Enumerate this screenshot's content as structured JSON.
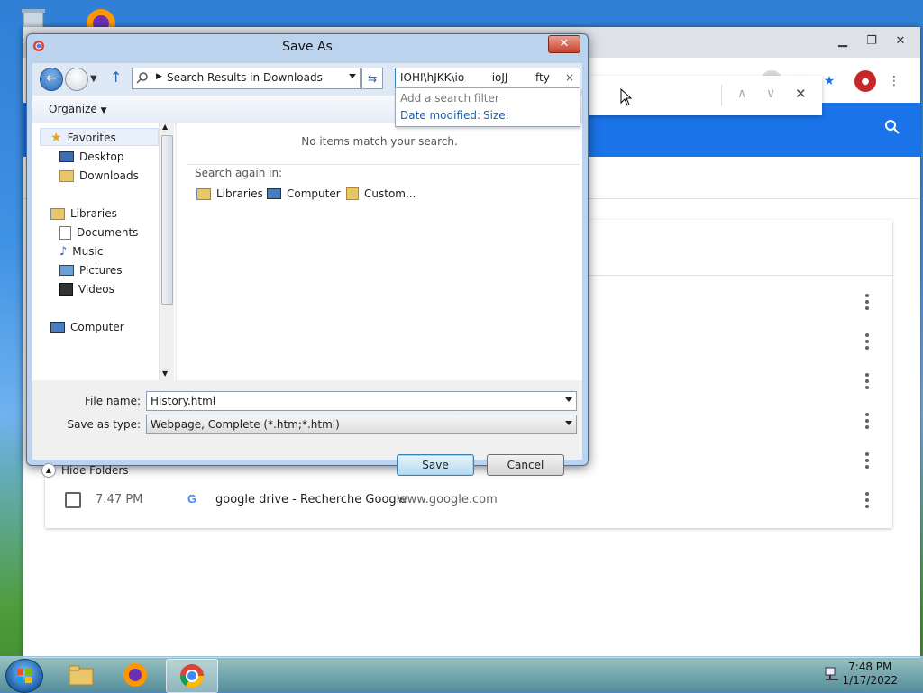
{
  "dialog": {
    "title": "Save As",
    "close_glyph": "✕",
    "address_text": "Search Results in Downloads",
    "search_text": "IOHI\\hJKK\\io        ioJJ        fty",
    "search_clear": "×",
    "filter": {
      "hint": "Add a search filter",
      "date_modified": "Date modified:",
      "size": "Size:"
    },
    "organize": "Organize",
    "nav": {
      "favorites": "Favorites",
      "desktop": "Desktop",
      "downloads": "Downloads",
      "libraries": "Libraries",
      "documents": "Documents",
      "music": "Music",
      "pictures": "Pictures",
      "videos": "Videos",
      "computer": "Computer"
    },
    "no_items": "No items match your search.",
    "search_again": "Search again in:",
    "search_locations": [
      "Libraries",
      "Computer",
      "Custom..."
    ],
    "file_name_label": "File name:",
    "file_name_value": "History.html",
    "save_type_label": "Save as type:",
    "save_type_value": "Webpage, Complete (*.htm;*.html)",
    "hide_folders": "Hide Folders",
    "save_button": "Save",
    "cancel_button": "Cancel"
  },
  "chrome": {
    "history_row": {
      "time": "7:47 PM",
      "title": "google drive - Recherche Google",
      "domain": "www.google.com"
    }
  },
  "taskbar": {
    "time": "7:48 PM",
    "date": "1/17/2022"
  },
  "colors": {
    "chrome_blue": "#1a73e8",
    "dialog_frame": "#bcd3ee",
    "close_red": "#c9412c"
  }
}
